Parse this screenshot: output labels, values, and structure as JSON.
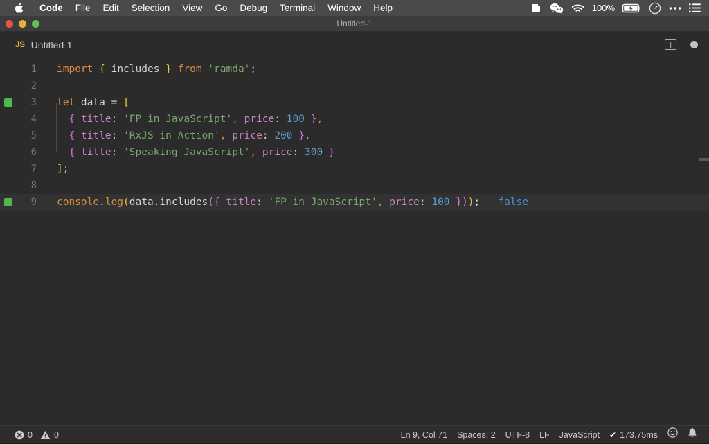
{
  "menubar": {
    "apple_icon": "apple-logo-icon",
    "items": [
      {
        "label": "Code",
        "bold": true
      },
      {
        "label": "File",
        "bold": false
      },
      {
        "label": "Edit",
        "bold": false
      },
      {
        "label": "Selection",
        "bold": false
      },
      {
        "label": "View",
        "bold": false
      },
      {
        "label": "Go",
        "bold": false
      },
      {
        "label": "Debug",
        "bold": false
      },
      {
        "label": "Terminal",
        "bold": false
      },
      {
        "label": "Window",
        "bold": false
      },
      {
        "label": "Help",
        "bold": false
      }
    ],
    "status": {
      "app_icon": "shield-app-icon",
      "wechat_icon": "wechat-icon",
      "wifi_icon": "wifi-icon",
      "battery_percent": "100%",
      "battery_icon": "battery-charging-icon",
      "clock_icon": "clock-icon",
      "more_icon": "ellipsis-icon",
      "list_icon": "list-icon"
    }
  },
  "window": {
    "title": "Untitled-1",
    "close_label": "close",
    "minimize_label": "minimize",
    "zoom_label": "zoom"
  },
  "tabbar": {
    "tab": {
      "badge": "JS",
      "label": "Untitled-1"
    },
    "split_editor_icon": "split-editor-icon",
    "unsaved_icon": "unsaved-dot-icon"
  },
  "editor": {
    "language": "JavaScript",
    "lines": [
      {
        "number": "1",
        "marker": false,
        "tokens": [
          {
            "t": "import",
            "c": "t-kw"
          },
          {
            "t": " ",
            "c": "t-plain"
          },
          {
            "t": "{",
            "c": "t-brace-y"
          },
          {
            "t": " includes ",
            "c": "t-plain"
          },
          {
            "t": "}",
            "c": "t-brace-y"
          },
          {
            "t": " ",
            "c": "t-plain"
          },
          {
            "t": "from",
            "c": "t-kw"
          },
          {
            "t": " ",
            "c": "t-plain"
          },
          {
            "t": "'ramda'",
            "c": "t-str"
          },
          {
            "t": ";",
            "c": "t-punc"
          }
        ]
      },
      {
        "number": "2",
        "marker": false,
        "tokens": []
      },
      {
        "number": "3",
        "marker": true,
        "tokens": [
          {
            "t": "let",
            "c": "t-kw"
          },
          {
            "t": " data ",
            "c": "t-plain"
          },
          {
            "t": "=",
            "c": "t-punc"
          },
          {
            "t": " ",
            "c": "t-plain"
          },
          {
            "t": "[",
            "c": "t-brace-y"
          }
        ]
      },
      {
        "number": "4",
        "marker": false,
        "tokens": [
          {
            "t": "  ",
            "c": "t-plain"
          },
          {
            "t": "{",
            "c": "t-brace-p"
          },
          {
            "t": " ",
            "c": "t-plain"
          },
          {
            "t": "title",
            "c": "t-prop"
          },
          {
            "t": ": ",
            "c": "t-punc"
          },
          {
            "t": "'FP in JavaScript'",
            "c": "t-str"
          },
          {
            "t": ",",
            "c": "t-comma"
          },
          {
            "t": " ",
            "c": "t-plain"
          },
          {
            "t": "price",
            "c": "t-prop"
          },
          {
            "t": ": ",
            "c": "t-punc"
          },
          {
            "t": "100",
            "c": "t-num"
          },
          {
            "t": " ",
            "c": "t-plain"
          },
          {
            "t": "}",
            "c": "t-brace-p"
          },
          {
            "t": ",",
            "c": "t-comma"
          }
        ]
      },
      {
        "number": "5",
        "marker": false,
        "tokens": [
          {
            "t": "  ",
            "c": "t-plain"
          },
          {
            "t": "{",
            "c": "t-brace-p"
          },
          {
            "t": " ",
            "c": "t-plain"
          },
          {
            "t": "title",
            "c": "t-prop"
          },
          {
            "t": ": ",
            "c": "t-punc"
          },
          {
            "t": "'RxJS in Action'",
            "c": "t-str"
          },
          {
            "t": ",",
            "c": "t-comma"
          },
          {
            "t": " ",
            "c": "t-plain"
          },
          {
            "t": "price",
            "c": "t-prop"
          },
          {
            "t": ": ",
            "c": "t-punc"
          },
          {
            "t": "200",
            "c": "t-num"
          },
          {
            "t": " ",
            "c": "t-plain"
          },
          {
            "t": "}",
            "c": "t-brace-p"
          },
          {
            "t": ",",
            "c": "t-comma"
          }
        ]
      },
      {
        "number": "6",
        "marker": false,
        "tokens": [
          {
            "t": "  ",
            "c": "t-plain"
          },
          {
            "t": "{",
            "c": "t-brace-p"
          },
          {
            "t": " ",
            "c": "t-plain"
          },
          {
            "t": "title",
            "c": "t-prop"
          },
          {
            "t": ": ",
            "c": "t-punc"
          },
          {
            "t": "'Speaking JavaScript'",
            "c": "t-str"
          },
          {
            "t": ",",
            "c": "t-comma"
          },
          {
            "t": " ",
            "c": "t-plain"
          },
          {
            "t": "price",
            "c": "t-prop"
          },
          {
            "t": ": ",
            "c": "t-punc"
          },
          {
            "t": "300",
            "c": "t-num"
          },
          {
            "t": " ",
            "c": "t-plain"
          },
          {
            "t": "}",
            "c": "t-brace-p"
          }
        ]
      },
      {
        "number": "7",
        "marker": false,
        "tokens": [
          {
            "t": "]",
            "c": "t-brace-y"
          },
          {
            "t": ";",
            "c": "t-punc"
          }
        ]
      },
      {
        "number": "8",
        "marker": false,
        "tokens": []
      },
      {
        "number": "9",
        "marker": true,
        "highlight": true,
        "tokens": [
          {
            "t": "console",
            "c": "t-kw"
          },
          {
            "t": ".",
            "c": "t-punc"
          },
          {
            "t": "log",
            "c": "t-kw"
          },
          {
            "t": "(",
            "c": "t-brace-y"
          },
          {
            "t": "data",
            "c": "t-plain"
          },
          {
            "t": ".",
            "c": "t-punc"
          },
          {
            "t": "includes",
            "c": "t-plain"
          },
          {
            "t": "(",
            "c": "t-paren-v"
          },
          {
            "t": "{",
            "c": "t-brace-p"
          },
          {
            "t": " ",
            "c": "t-plain"
          },
          {
            "t": "title",
            "c": "t-prop"
          },
          {
            "t": ": ",
            "c": "t-punc"
          },
          {
            "t": "'FP in JavaScript'",
            "c": "t-str"
          },
          {
            "t": ",",
            "c": "t-comma"
          },
          {
            "t": " ",
            "c": "t-plain"
          },
          {
            "t": "price",
            "c": "t-prop"
          },
          {
            "t": ": ",
            "c": "t-punc"
          },
          {
            "t": "100",
            "c": "t-num"
          },
          {
            "t": " ",
            "c": "t-plain"
          },
          {
            "t": "}",
            "c": "t-brace-p"
          },
          {
            "t": ")",
            "c": "t-paren-v"
          },
          {
            "t": ")",
            "c": "t-brace-y"
          },
          {
            "t": ";",
            "c": "t-punc"
          },
          {
            "t": "   ",
            "c": "t-plain"
          },
          {
            "t": "false",
            "c": "t-result"
          }
        ]
      }
    ]
  },
  "statusbar": {
    "error_icon": "error-circle-icon",
    "error_count": "0",
    "warning_icon": "warning-triangle-icon",
    "warning_count": "0",
    "cursor_position": "Ln 9, Col 71",
    "indentation": "Spaces: 2",
    "encoding": "UTF-8",
    "eol": "LF",
    "language_mode": "JavaScript",
    "run_check_icon": "check-icon",
    "run_time": "173.75ms",
    "feedback_icon": "smiley-icon",
    "notifications_icon": "bell-icon"
  },
  "colors": {
    "menubar_bg": "#4a4a4a",
    "titlebar_bg": "#3c3c3c",
    "editor_bg": "#2b2b2b",
    "statusbar_bg": "#2d2d2d",
    "run_marker": "#4fb950",
    "js_badge": "#e2c438",
    "result_text": "#4a90d9"
  }
}
